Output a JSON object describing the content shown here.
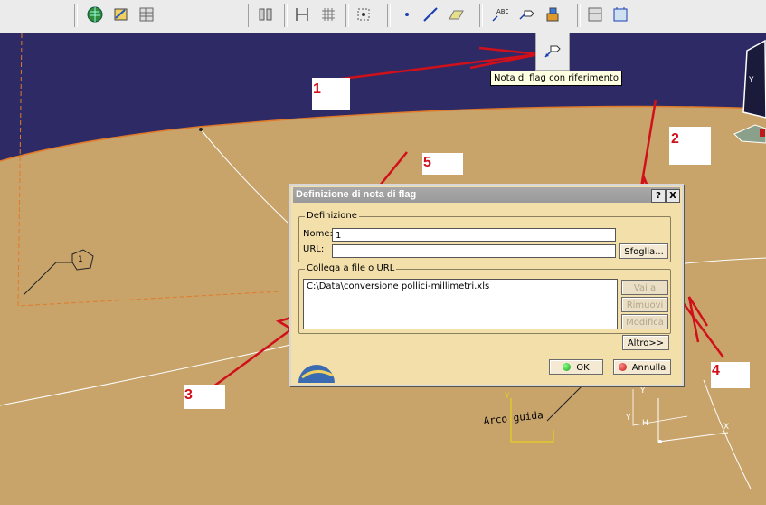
{
  "tooltip": {
    "text": "Nota di flag con riferimento"
  },
  "viewport": {
    "annotation_text": "Arco guida",
    "flag_number": "1"
  },
  "callouts": [
    "1",
    "2",
    "3",
    "4",
    "5"
  ],
  "dialog": {
    "title": "Definizione di nota di flag",
    "help_btn": "?",
    "close_btn": "X",
    "group_definition": {
      "legend": "Definizione",
      "name_label": "Nome:",
      "name_value": "1",
      "url_label": "URL:",
      "url_value": "",
      "browse_button": "Sfoglia..."
    },
    "group_link": {
      "legend": "Collega a file o URL",
      "items": [
        "C:\\Data\\conversione pollici-millimetri.xls"
      ],
      "go_button": "Vai a",
      "remove_button": "Rimuovi",
      "modify_button": "Modifica"
    },
    "more_button": "Altro>>",
    "ok_button": "OK",
    "cancel_button": "Annulla"
  },
  "colors": {
    "sky": "#2e2a66",
    "surface": "#c8a46a",
    "dialog_bg": "#f2dfaa",
    "annotation_red": "#d0101a",
    "edge_orange": "#e07a2a",
    "ok_green": "#1aa01a",
    "cancel_red": "#c01818"
  }
}
